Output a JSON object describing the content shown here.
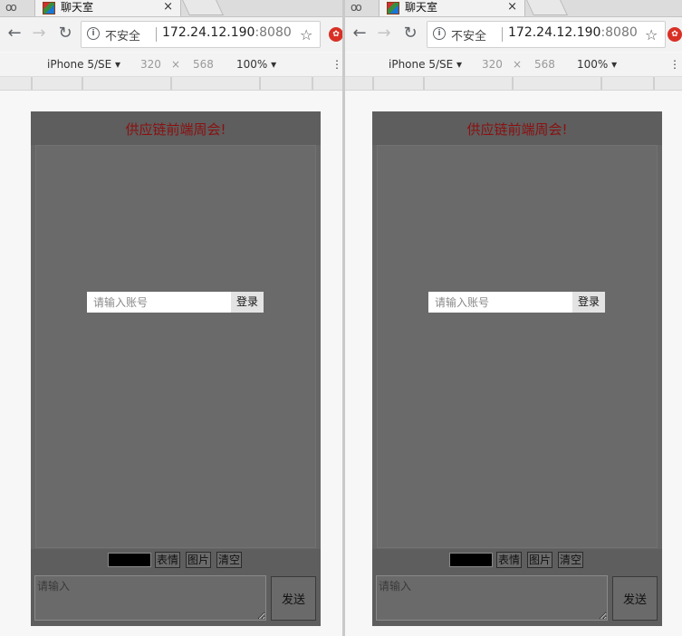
{
  "browser": {
    "tab_title": "聊天室",
    "tab_close": "×",
    "security_label": "不安全",
    "url_host": "172.24.12.190",
    "url_port": ":8080",
    "back_glyph": "←",
    "forward_glyph": "→",
    "reload_glyph": "↻",
    "star_glyph": "☆",
    "menu_glyph": "⋮",
    "tab_menu_glyph": "oo"
  },
  "devtools": {
    "device": "iPhone 5/SE ▾",
    "width": "320",
    "times": "×",
    "height": "568",
    "zoom": "100% ▾",
    "menu": "⋮"
  },
  "chat": {
    "title": "供应链前端周会!",
    "account_placeholder": "请输入账号",
    "login_label": "登录",
    "emoji_label": "表情",
    "image_label": "图片",
    "clear_label": "清空",
    "message_placeholder": "请输入",
    "send_label": "发送"
  },
  "colors": {
    "title_color": "#8b1010",
    "panel_bg": "#666666",
    "extension_icon": "#d93025"
  },
  "icons": [
    "tab-menu-icon",
    "favicon-icon",
    "close-icon",
    "back-icon",
    "forward-icon",
    "reload-icon",
    "info-icon",
    "star-icon",
    "extension-icon",
    "menu-icon"
  ]
}
